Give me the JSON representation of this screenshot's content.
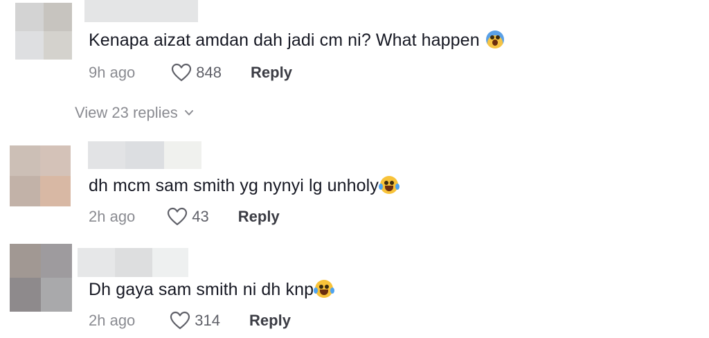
{
  "comments": [
    {
      "text": "Kenapa aizat amdan dah jadi cm ni? What happen",
      "emoji": "face-screaming-in-fear-icon",
      "time": "9h ago",
      "likes": "848",
      "reply_label": "Reply"
    },
    {
      "text": "dh mcm sam smith yg nynyi lg unholy",
      "emoji": "face-with-tears-of-joy-icon",
      "time": "2h ago",
      "likes": "43",
      "reply_label": "Reply"
    },
    {
      "text": "Dh gaya sam smith ni dh knp",
      "emoji": "face-with-tears-of-joy-icon",
      "time": "2h ago",
      "likes": "314",
      "reply_label": "Reply"
    }
  ],
  "view_replies": {
    "label": "View 23 replies"
  },
  "colors": {
    "text": "#161823",
    "secondary": "#8a8b91",
    "reply": "#3b3c44"
  }
}
